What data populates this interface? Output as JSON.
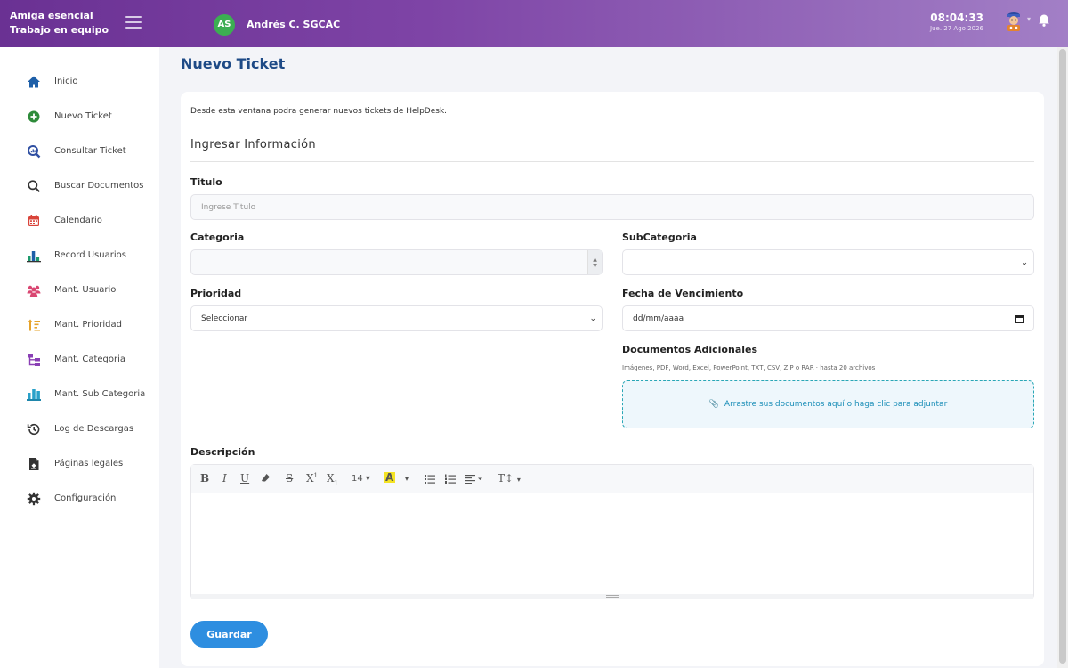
{
  "header": {
    "brand_line1": "Amiga esencial",
    "brand_line2": "Trabajo en equipo",
    "avatar_initials": "AS",
    "user_name": "Andrés C. SGCAC",
    "time": "08:04:33",
    "date": "Jue. 27 Ago 2026"
  },
  "sidebar": {
    "items": [
      {
        "label": "Inicio",
        "icon": "home-icon",
        "color": "#1e5fa8"
      },
      {
        "label": "Nuevo Ticket",
        "icon": "plus-circle-icon",
        "color": "#2e8b3a"
      },
      {
        "label": "Consultar Ticket",
        "icon": "magnifier-chart-icon",
        "color": "#2f4fa2"
      },
      {
        "label": "Buscar Documentos",
        "icon": "search-icon",
        "color": "#333333"
      },
      {
        "label": "Calendario",
        "icon": "calendar-icon",
        "color": "#d9443a"
      },
      {
        "label": "Record Usuarios",
        "icon": "bar-chart-icon",
        "color": "#1d9a6c"
      },
      {
        "label": "Mant. Usuario",
        "icon": "users-icon",
        "color": "#d94772"
      },
      {
        "label": "Mant. Prioridad",
        "icon": "sort-priority-icon",
        "color": "#e6a32b"
      },
      {
        "label": "Mant. Categoria",
        "icon": "sitemap-icon",
        "color": "#8a3fb5"
      },
      {
        "label": "Mant. Sub Categoria",
        "icon": "sub-category-icon",
        "color": "#2aa1c9"
      },
      {
        "label": "Log de Descargas",
        "icon": "history-icon",
        "color": "#333333"
      },
      {
        "label": "Páginas legales",
        "icon": "legal-document-icon",
        "color": "#333333"
      },
      {
        "label": "Configuración",
        "icon": "gear-icon",
        "color": "#333333"
      }
    ]
  },
  "main": {
    "page_title": "Nuevo Ticket",
    "intro": "Desde esta ventana podra generar nuevos tickets de HelpDesk.",
    "section_title": "Ingresar Información",
    "titulo_label": "Titulo",
    "titulo_placeholder": "Ingrese Titulo",
    "categoria_label": "Categoria",
    "categoria_value": "",
    "subcategoria_label": "SubCategoria",
    "subcategoria_value": "",
    "prioridad_label": "Prioridad",
    "prioridad_value": "Seleccionar",
    "fecha_label": "Fecha de Vencimiento",
    "fecha_placeholder": "dd/mm/aaaa",
    "docs_label": "Documentos Adicionales",
    "docs_hint": "Imágenes, PDF, Word, Excel, PowerPoint, TXT, CSV, ZIP o RAR · hasta 20 archivos",
    "dropzone_text": "Arrastre sus documentos aquí o haga clic para adjuntar",
    "descripcion_label": "Descripción",
    "font_size": "14",
    "save_label": "Guardar"
  }
}
